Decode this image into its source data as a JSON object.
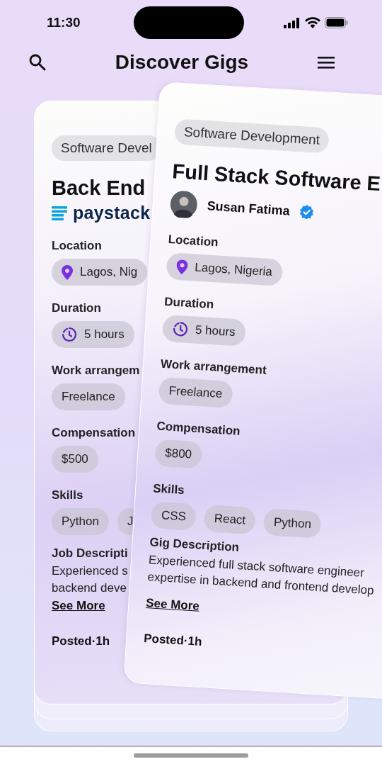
{
  "status_bar": {
    "time": "11:30"
  },
  "header": {
    "title": "Discover Gigs"
  },
  "cards": [
    {
      "kind": "company",
      "category": "Software Devel",
      "title": "Back End",
      "company": "paystack",
      "fields": [
        {
          "label": "Location",
          "kind": "location",
          "values": [
            "Lagos, Nig"
          ]
        },
        {
          "label": "Duration",
          "kind": "duration",
          "values": [
            "5 hours"
          ]
        },
        {
          "label": "Work arrangem",
          "kind": "plain",
          "values": [
            "Freelance"
          ]
        },
        {
          "label": "Compensation",
          "kind": "plain",
          "values": [
            "$500"
          ]
        },
        {
          "label": "Skills",
          "kind": "plain",
          "values": [
            "Python",
            "J"
          ]
        }
      ],
      "description_label": "Job Descripti",
      "description_lines": [
        "Experienced s",
        "backend deve"
      ],
      "see_more": "See More",
      "posted": "Posted·1h"
    },
    {
      "kind": "person",
      "category": "Software Development",
      "title": "Full Stack Software E",
      "poster": {
        "name": "Susan Fatima",
        "verified": true
      },
      "fields": [
        {
          "label": "Location",
          "kind": "location",
          "values": [
            "Lagos, Nigeria"
          ]
        },
        {
          "label": "Duration",
          "kind": "duration",
          "values": [
            "5 hours"
          ]
        },
        {
          "label": "Work arrangement",
          "kind": "plain",
          "values": [
            "Freelance"
          ]
        },
        {
          "label": "Compensation",
          "kind": "plain",
          "values": [
            "$800"
          ]
        },
        {
          "label": "Skills",
          "kind": "plain",
          "values": [
            "CSS",
            "React",
            "Python"
          ]
        }
      ],
      "description_label": "Gig Description",
      "description_lines": [
        "Experienced full stack software engineer",
        "expertise in backend and frontend develop"
      ],
      "see_more": "See More",
      "posted": "Posted·1h"
    }
  ]
}
